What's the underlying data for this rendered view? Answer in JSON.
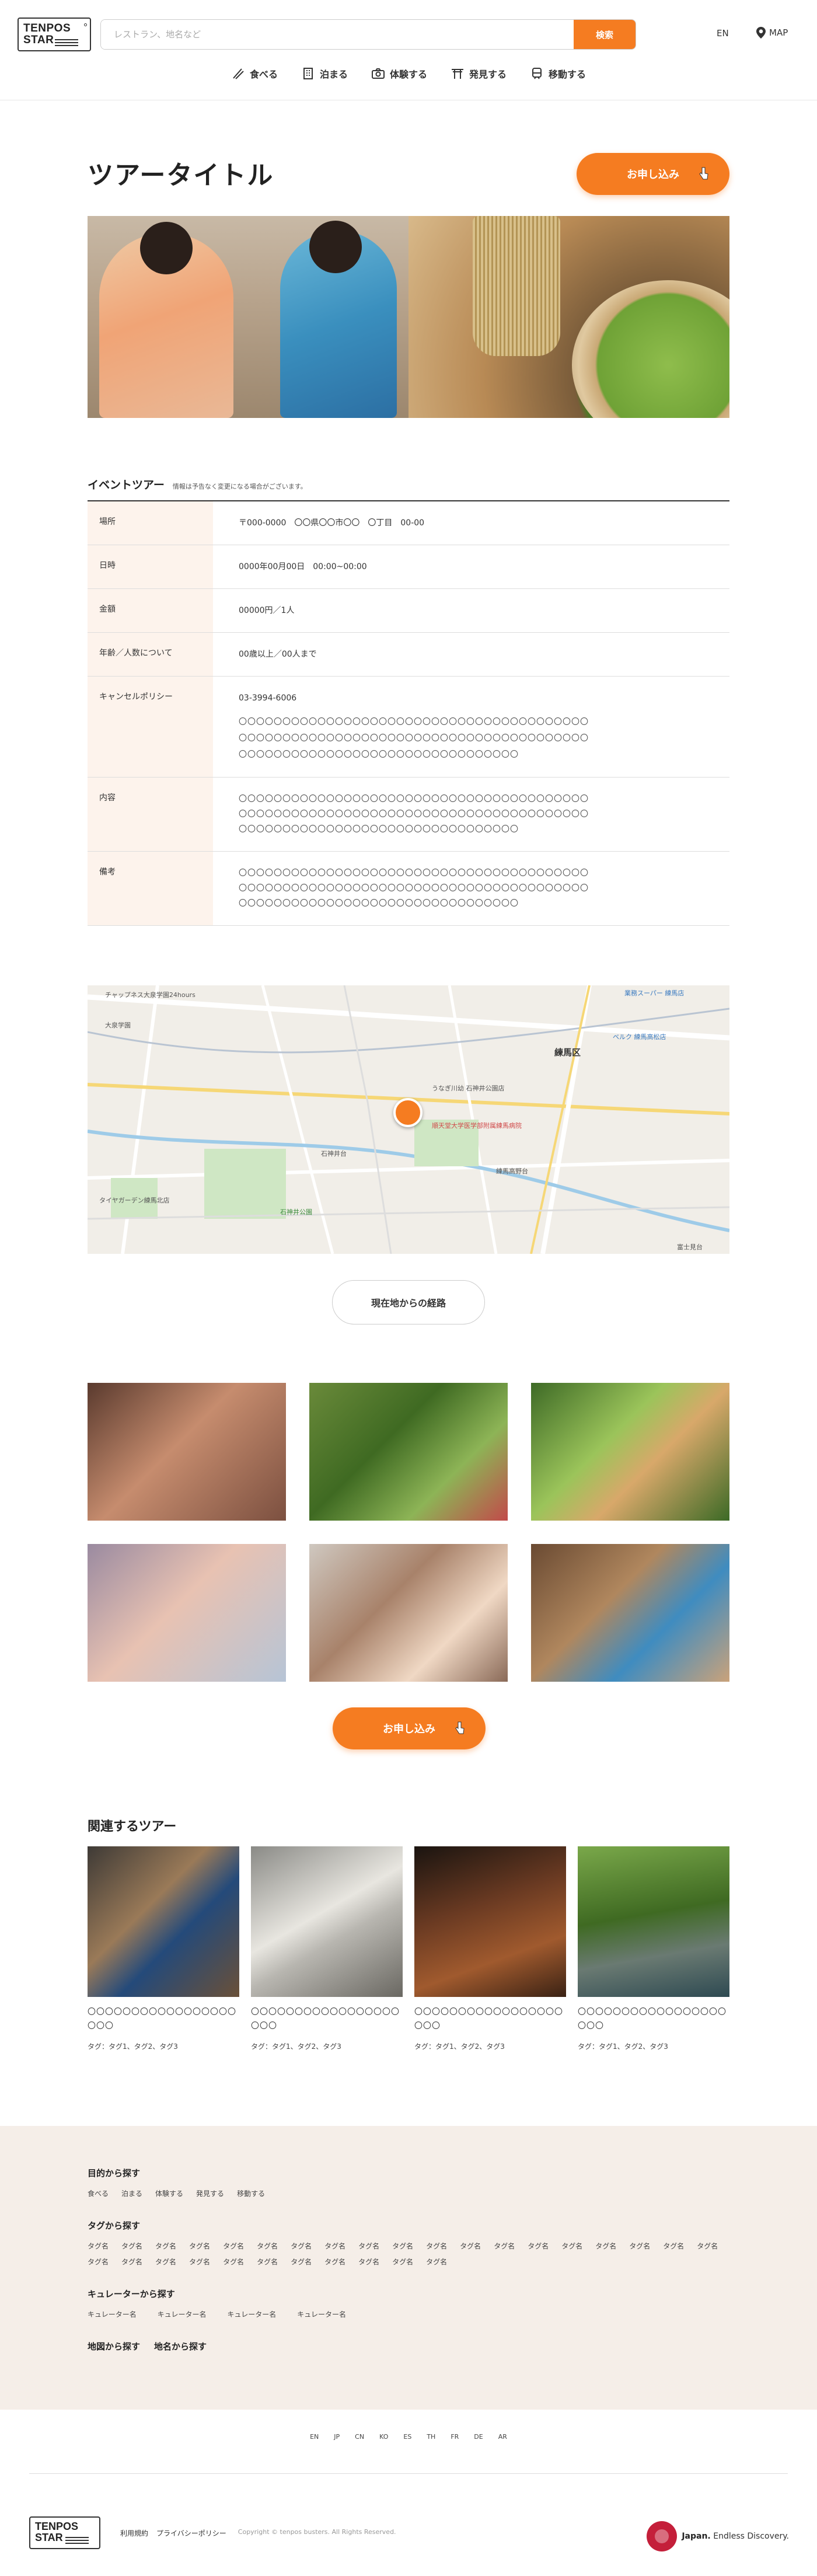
{
  "header": {
    "logo_line1": "TENPOS",
    "logo_line2": "STAR",
    "search_placeholder": "レストラン、地名など",
    "search_button": "検索",
    "lang": "EN",
    "map": "MAP",
    "nav": [
      {
        "label": "食べる",
        "icon": "chopsticks-icon"
      },
      {
        "label": "泊まる",
        "icon": "building-icon"
      },
      {
        "label": "体験する",
        "icon": "camera-icon"
      },
      {
        "label": "発見する",
        "icon": "torii-icon"
      },
      {
        "label": "移動する",
        "icon": "train-icon"
      }
    ]
  },
  "tour": {
    "title": "ツアータイトル",
    "apply_label": "お申し込み"
  },
  "info": {
    "heading": "イベントツアー",
    "note": "情報は予告なく変更になる場合がございます。",
    "rows": [
      {
        "key": "場所",
        "value": "〒000-0000　〇〇県〇〇市〇〇　〇丁目　00-00"
      },
      {
        "key": "日時",
        "value": "0000年00月00日　00:00~00:00"
      },
      {
        "key": "金額",
        "value": "00000円／1人"
      },
      {
        "key": "年齢／人数について",
        "value": "00歳以上／00人まで"
      }
    ],
    "cancel": {
      "key": "キャンセルポリシー",
      "phone": "03-3994-6006",
      "lines": [
        "〇〇〇〇〇〇〇〇〇〇〇〇〇〇〇〇〇〇〇〇〇〇〇〇〇〇〇〇〇〇〇〇〇〇〇〇〇〇〇〇",
        "〇〇〇〇〇〇〇〇〇〇〇〇〇〇〇〇〇〇〇〇〇〇〇〇〇〇〇〇〇〇〇〇〇〇〇〇〇〇〇〇",
        "〇〇〇〇〇〇〇〇〇〇〇〇〇〇〇〇〇〇〇〇〇〇〇〇〇〇〇〇〇〇〇〇"
      ]
    },
    "content": {
      "key": "内容",
      "lines": [
        "〇〇〇〇〇〇〇〇〇〇〇〇〇〇〇〇〇〇〇〇〇〇〇〇〇〇〇〇〇〇〇〇〇〇〇〇〇〇〇〇",
        "〇〇〇〇〇〇〇〇〇〇〇〇〇〇〇〇〇〇〇〇〇〇〇〇〇〇〇〇〇〇〇〇〇〇〇〇〇〇〇〇",
        "〇〇〇〇〇〇〇〇〇〇〇〇〇〇〇〇〇〇〇〇〇〇〇〇〇〇〇〇〇〇〇〇"
      ]
    },
    "notes": {
      "key": "備考",
      "lines": [
        "〇〇〇〇〇〇〇〇〇〇〇〇〇〇〇〇〇〇〇〇〇〇〇〇〇〇〇〇〇〇〇〇〇〇〇〇〇〇〇〇",
        "〇〇〇〇〇〇〇〇〇〇〇〇〇〇〇〇〇〇〇〇〇〇〇〇〇〇〇〇〇〇〇〇〇〇〇〇〇〇〇〇",
        "〇〇〇〇〇〇〇〇〇〇〇〇〇〇〇〇〇〇〇〇〇〇〇〇〇〇〇〇〇〇〇〇"
      ]
    }
  },
  "map": {
    "labels": [
      "チャップネス大泉学園24hours",
      "大泉学園",
      "練馬区",
      "うなぎ川幼 石神井公園店",
      "順天堂大学医学部附属練馬病院",
      "タイヤガーデン練馬北店",
      "石神井公園",
      "練馬高野台",
      "石神井台",
      "ベルク 練馬高松店",
      "業務スーパー 練馬店",
      "富士見台"
    ],
    "route_label": "現在地からの経路"
  },
  "related": {
    "heading": "関連するツアー",
    "items": [
      {
        "title": "〇〇〇〇〇〇〇〇〇〇〇〇〇〇〇〇〇〇〇〇",
        "tags": "タグ：タグ1、タグ2、タグ3"
      },
      {
        "title": "〇〇〇〇〇〇〇〇〇〇〇〇〇〇〇〇〇〇〇〇",
        "tags": "タグ：タグ1、タグ2、タグ3"
      },
      {
        "title": "〇〇〇〇〇〇〇〇〇〇〇〇〇〇〇〇〇〇〇〇",
        "tags": "タグ：タグ1、タグ2、タグ3"
      },
      {
        "title": "〇〇〇〇〇〇〇〇〇〇〇〇〇〇〇〇〇〇〇〇",
        "tags": "タグ：タグ1、タグ2、タグ3"
      }
    ]
  },
  "footer": {
    "purpose_heading": "目的から探す",
    "purpose_links": [
      "食べる",
      "泊まる",
      "体験する",
      "発見する",
      "移動する"
    ],
    "tags_heading": "タグから探す",
    "tag_label": "タグ名",
    "curator_heading": "キュレーターから探す",
    "curator_label": "キュレーター名",
    "map_search": "地図から探す",
    "place_search": "地名から探す",
    "languages": [
      "EN",
      "JP",
      "CN",
      "KO",
      "ES",
      "TH",
      "FR",
      "DE",
      "AR"
    ],
    "logo_line1": "TENPOS",
    "logo_line2": "STAR",
    "terms": "利用規約",
    "privacy": "プライバシーポリシー",
    "copyright": "Copyright © tenpos busters. All Rights Reserved.",
    "japan_brand": "Japan.",
    "japan_tagline": "Endless Discovery."
  },
  "colors": {
    "accent": "#f57c21",
    "label_bg": "#fdf3ec",
    "footer_bg": "#f5eee8"
  }
}
